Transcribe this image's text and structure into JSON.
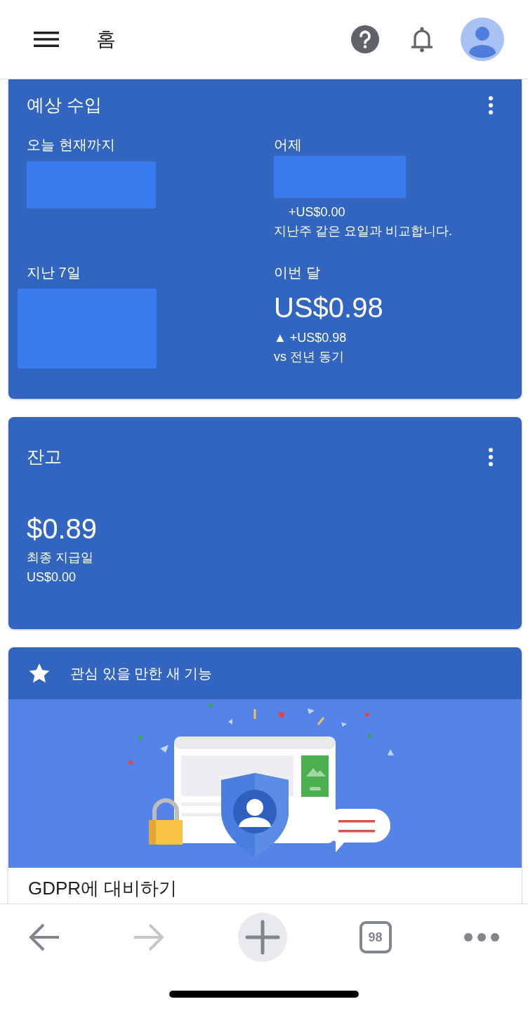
{
  "header": {
    "title": "홈"
  },
  "estimated_earnings": {
    "title": "예상 수입",
    "metrics": [
      {
        "label": "오늘 현재까지",
        "kind": "redacted"
      },
      {
        "label": "어제",
        "kind": "redacted",
        "change": "+US$0.00",
        "note": "지난주 같은 요일과 비교합니다."
      },
      {
        "label": "지난 7일",
        "kind": "redacted"
      },
      {
        "label": "이번 달",
        "kind": "value",
        "value": "US$0.98",
        "change": "▲ +US$0.98",
        "note": "vs 전년 동기"
      }
    ]
  },
  "balance": {
    "title": "잔고",
    "amount": "$0.89",
    "last_payment_label": "최종 지급일",
    "last_payment_amount": "US$0.00"
  },
  "feature_card": {
    "title": "관심 있을 만한 새 기능",
    "heading": "GDPR에 대비하기"
  },
  "bottom_bar": {
    "tab_count": "98",
    "forward_disabled": true
  }
}
